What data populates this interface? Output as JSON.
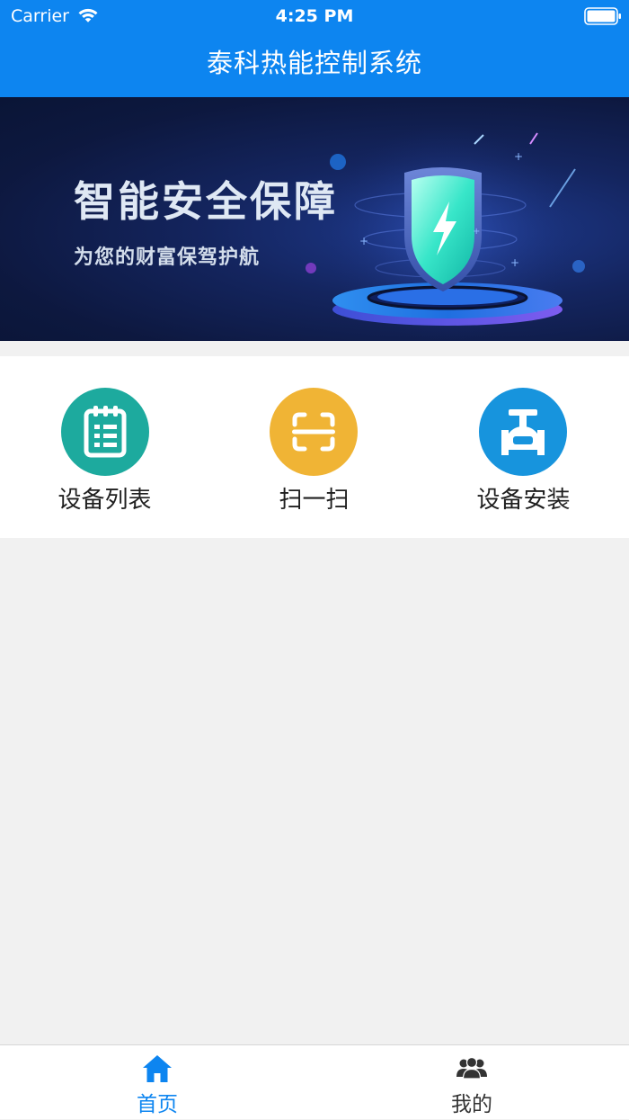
{
  "status_bar": {
    "carrier": "Carrier",
    "time": "4:25 PM"
  },
  "nav": {
    "title": "泰科热能控制系统"
  },
  "banner": {
    "headline": "智能安全保障",
    "subline": "为您的财富保驾护航"
  },
  "actions": [
    {
      "label": "设备列表",
      "icon": "clipboard-list-icon",
      "color": "#1daa9e"
    },
    {
      "label": "扫一扫",
      "icon": "scan-icon",
      "color": "#f0b435"
    },
    {
      "label": "设备安装",
      "icon": "valve-icon",
      "color": "#1794dd"
    }
  ],
  "tabs": [
    {
      "label": "首页",
      "icon": "home-icon",
      "active": true
    },
    {
      "label": "我的",
      "icon": "users-icon",
      "active": false
    }
  ],
  "colors": {
    "primary": "#0d85f0",
    "active_tab": "#0d85f0",
    "inactive_tab": "#333333",
    "page_background": "#f1f1f1"
  }
}
